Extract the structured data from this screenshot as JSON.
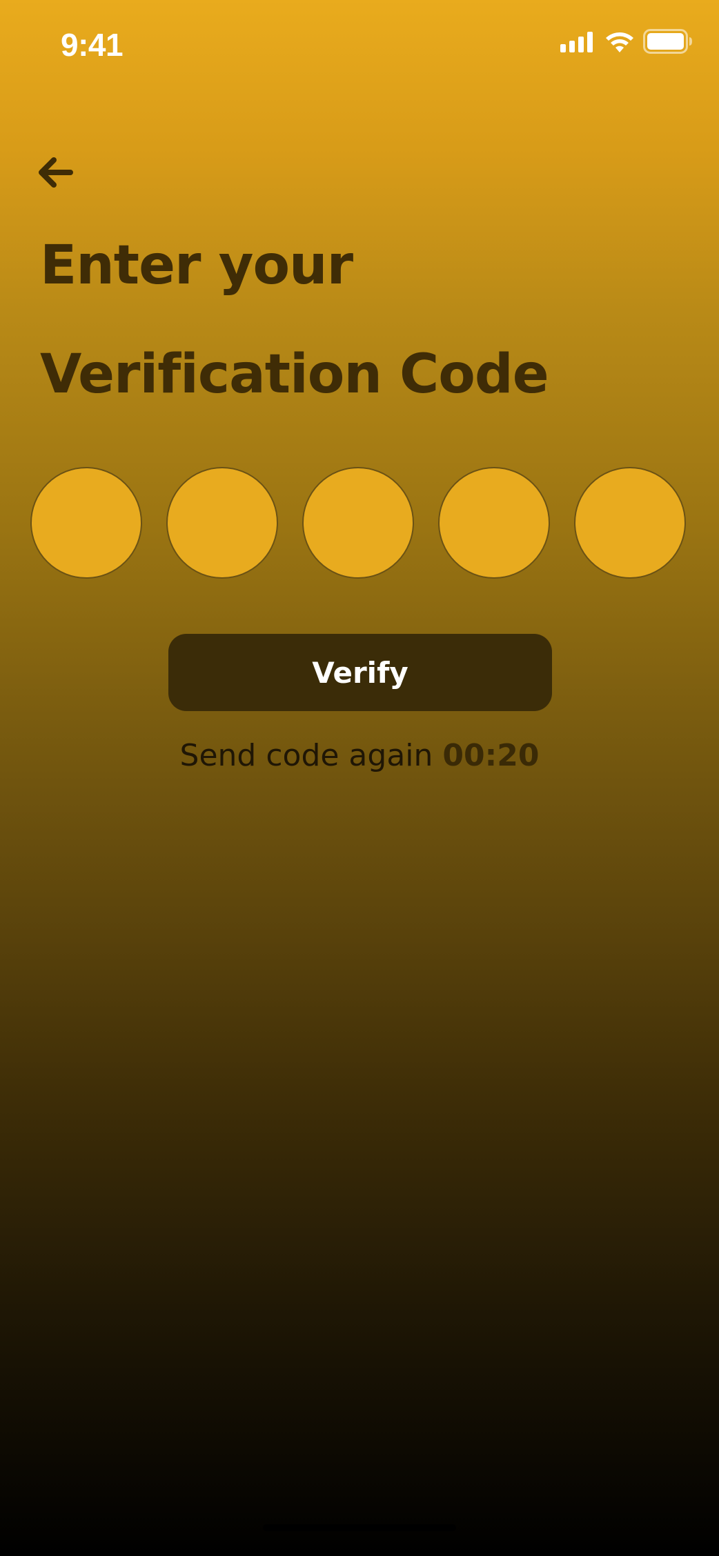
{
  "status_bar": {
    "time": "9:41",
    "icons": [
      "signal-icon",
      "wifi-icon",
      "battery-icon"
    ],
    "color": "#FFFFFF"
  },
  "navigation": {
    "back_icon": "arrow-left-icon"
  },
  "title": {
    "line1": "Enter your",
    "line2": "Verification Code"
  },
  "otp": {
    "digits": [
      "",
      "",
      "",
      "",
      ""
    ]
  },
  "actions": {
    "verify_label": "Verify"
  },
  "resend": {
    "label": "Send code again",
    "timer": "00:20"
  },
  "colors": {
    "gradient_top": "#E9AB1D",
    "gradient_bottom": "#000000",
    "title_text": "#3F2C06",
    "otp_fill": "#E8AB1F",
    "otp_border": "#6B5214",
    "button_bg": "#3B2C08",
    "button_text": "#FFFFFF"
  }
}
